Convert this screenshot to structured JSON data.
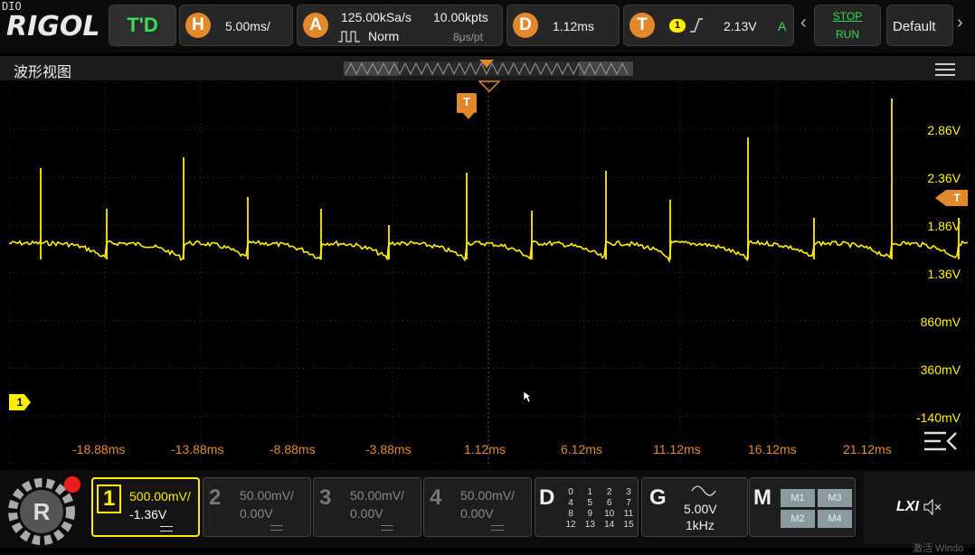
{
  "top": {
    "dio": "DIO",
    "logo": "RIGOL",
    "mode": "T'D",
    "horizontal": {
      "badge": "H",
      "value": "5.00ms/"
    },
    "acquire": {
      "badge": "A",
      "sample_rate": "125.00kSa/s",
      "points": "10.00kpts",
      "mode": "Norm",
      "per_pt": "8μs/pt"
    },
    "delay": {
      "badge": "D",
      "value": "1.12ms"
    },
    "trigger": {
      "badge": "T",
      "channel": "1",
      "level": "2.13V",
      "status": "A"
    },
    "stop": "STOP",
    "run": "RUN",
    "default": "Default"
  },
  "waveform_view": {
    "title": "波形视图",
    "trigger_marker": "T",
    "channel_marker": "1",
    "time_labels": [
      "-18.88ms",
      "-13.88ms",
      "-8.88ms",
      "-3.88ms",
      "1.12ms",
      "6.12ms",
      "11.12ms",
      "16.12ms",
      "21.12ms"
    ],
    "volt_labels": [
      "2.86V",
      "2.36V",
      "1.86V",
      "1.36V",
      "860mV",
      "360mV",
      "-140mV"
    ]
  },
  "channels": [
    {
      "num": "1",
      "scale": "500.00mV/",
      "offset": "-1.36V",
      "active": true
    },
    {
      "num": "2",
      "scale": "50.00mV/",
      "offset": "0.00V",
      "active": false
    },
    {
      "num": "3",
      "scale": "50.00mV/",
      "offset": "0.00V",
      "active": false
    },
    {
      "num": "4",
      "scale": "50.00mV/",
      "offset": "0.00V",
      "active": false
    }
  ],
  "digital": {
    "badge": "D",
    "rows": [
      [
        "0",
        "1",
        "2",
        "3"
      ],
      [
        "4",
        "5",
        "6",
        "7"
      ],
      [
        "8",
        "9",
        "10",
        "11"
      ],
      [
        "12",
        "13",
        "14",
        "15"
      ]
    ]
  },
  "generator": {
    "badge": "G",
    "amp": "5.00V",
    "freq": "1kHz"
  },
  "math": {
    "badge": "M",
    "items": [
      "M1",
      "M3",
      "M2",
      "M4"
    ]
  },
  "lxi": "LXI",
  "watermark": "激活 Windo",
  "colors": {
    "accent": "#e2892c",
    "ch1": "#ffee00",
    "stop": "#33dd55"
  }
}
